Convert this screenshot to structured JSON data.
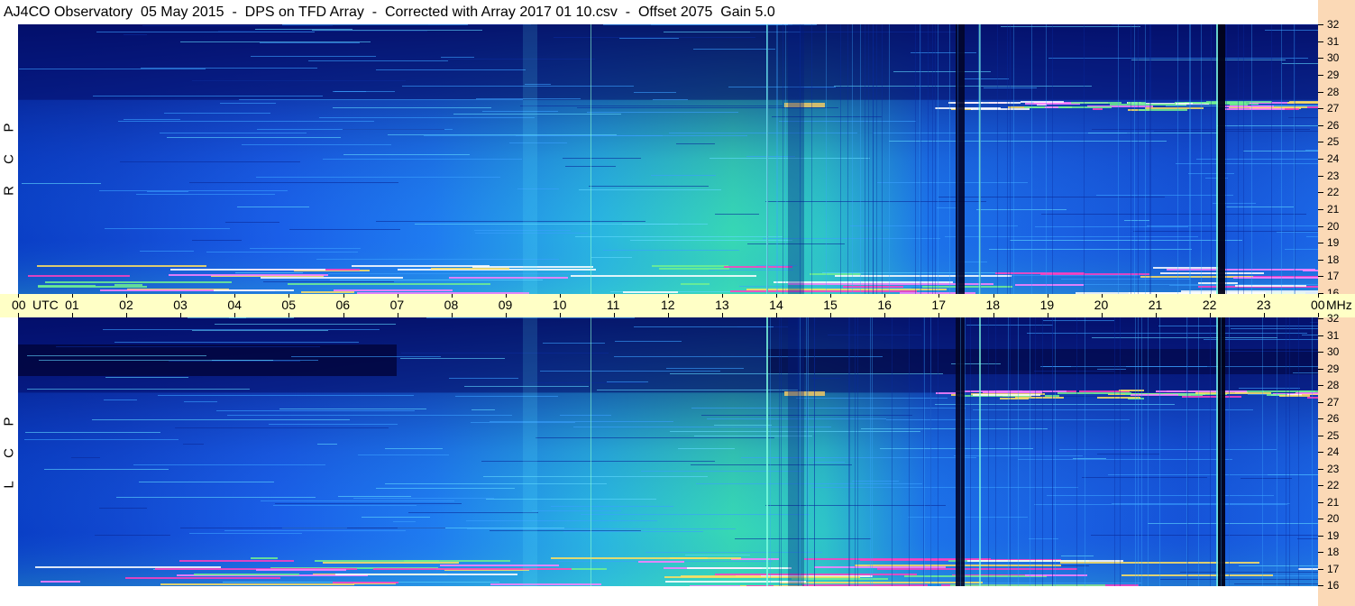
{
  "window": {
    "title": "AJ4CO Observatory  05 May 2015  -  DPS on TFD Array  -  Corrected with Array 2017 01 10.csv  -  Offset 2075  Gain 5.0"
  },
  "panels": {
    "top": {
      "label_letters": [
        "P",
        "C",
        "R"
      ]
    },
    "bottom": {
      "label_letters": [
        "P",
        "C",
        "L"
      ]
    }
  },
  "frequency_axis": {
    "labels": [
      "32",
      "31",
      "30",
      "29",
      "28",
      "27",
      "26",
      "25",
      "24",
      "23",
      "22",
      "21",
      "20",
      "19",
      "18",
      "17",
      "16"
    ],
    "unit": "MHz"
  },
  "time_axis": {
    "labels": [
      "00",
      "01",
      "02",
      "03",
      "04",
      "05",
      "06",
      "07",
      "08",
      "09",
      "10",
      "11",
      "12",
      "13",
      "14",
      "15",
      "16",
      "17",
      "18",
      "19",
      "20",
      "21",
      "22",
      "23",
      "00"
    ],
    "utc_label": "UTC",
    "unit_label": "MHz"
  },
  "colors": {
    "axis_background": "#fbd9b6",
    "time_bar_background": "#ffffc6",
    "spectrogram_dark": "#03075a",
    "spectrogram_mid": "#1a63f0",
    "spectrogram_light": "#3fe0a0"
  }
}
